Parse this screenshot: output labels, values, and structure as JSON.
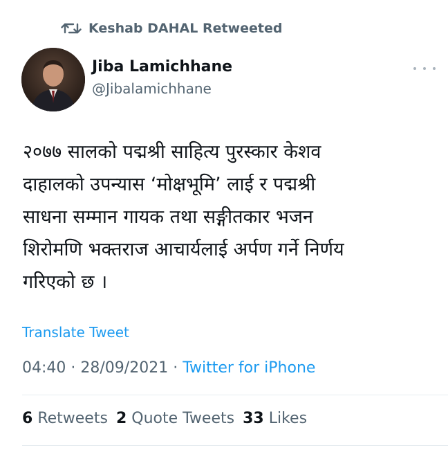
{
  "retweet": {
    "icon": "retweet-icon",
    "text": "Keshab DAHAL Retweeted"
  },
  "author": {
    "name": "Jiba Lamichhane",
    "handle": "@Jibalamichhane",
    "avatar": "avatar-photo"
  },
  "more_icon": "more-options-icon",
  "tweet": {
    "text": "२०७७ सालको पद्मश्री साहित्य पुरस्कार केशव\nदाहालको उपन्यास ‘मोक्षभूमि’ लाई र पद्मश्री\nसाधना सम्मान गायक तथा सङ्गीतकार भजन\nशिरोमणि भक्तराज आचार्यलाई अर्पण गर्ने निर्णय\nगरिएको छ ।"
  },
  "translate": "Translate Tweet",
  "meta": {
    "time": "04:40",
    "sep1": " · ",
    "date": "28/09/2021",
    "sep2": " · ",
    "source": "Twitter for iPhone"
  },
  "stats": {
    "retweets_count": "6",
    "retweets_label": "Retweets",
    "quotes_count": "2",
    "quotes_label": "Quote Tweets",
    "likes_count": "33",
    "likes_label": "Likes"
  },
  "colors": {
    "accent": "#1d9bf0",
    "secondary_text": "#536471",
    "primary_text": "#0f1419"
  }
}
